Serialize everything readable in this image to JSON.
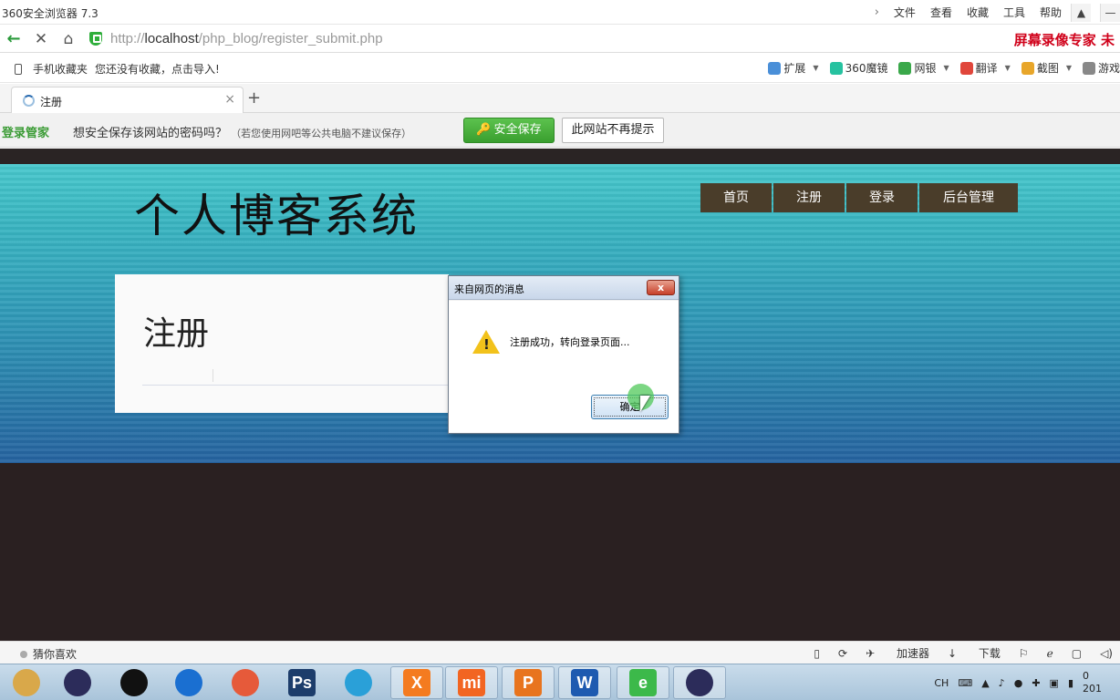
{
  "browser": {
    "title": "360安全浏览器 7.3",
    "menu": [
      "文件",
      "查看",
      "收藏",
      "工具",
      "帮助"
    ],
    "url_scheme": "http://",
    "url_host": "localhost",
    "url_path": "/php_blog/register_submit.php",
    "recorder_brand": "屏幕录像专家 未"
  },
  "bookmarks": {
    "mobile_label": "手机收藏夹",
    "empty_hint": "您还没有收藏，点击导入!",
    "tools": [
      {
        "label": "扩展",
        "color": "#4a8fd8"
      },
      {
        "label": "360魔镜",
        "color": "#26c2a0"
      },
      {
        "label": "网银",
        "color": "#3aa84a"
      },
      {
        "label": "翻译",
        "color": "#e0463b"
      },
      {
        "label": "截图",
        "color": "#e8a62a"
      },
      {
        "label": "游戏",
        "color": "#888888"
      }
    ]
  },
  "tab": {
    "title": "注册",
    "close": "×",
    "new_tab": "+"
  },
  "password_bar": {
    "brand": "登录管家",
    "question": "想安全保存该网站的密码吗？",
    "note": "（若您使用网吧等公共电脑不建议保存）",
    "save_label": "安全保存",
    "dismiss_label": "此网站不再提示"
  },
  "site": {
    "title": "个人博客系统",
    "nav": [
      {
        "label": "首页",
        "width": 78
      },
      {
        "label": "注册",
        "width": 78
      },
      {
        "label": "登录",
        "width": 78
      },
      {
        "label": "后台管理",
        "width": 108
      }
    ],
    "panel_heading": "注册"
  },
  "dialog": {
    "title": "来自网页的消息",
    "message": "注册成功，转向登录页面...",
    "ok_label": "确定",
    "close_glyph": "x"
  },
  "statusbar": {
    "guess": "猜你喜欢",
    "accelerator": "加速器",
    "download": "下载"
  },
  "taskbar": {
    "apps": [
      {
        "name": "file-explorer",
        "color": "#d9a84a",
        "glyph": ""
      },
      {
        "name": "eclipse",
        "color": "#2c2c5a",
        "glyph": ""
      },
      {
        "name": "qq",
        "color": "#111111",
        "glyph": ""
      },
      {
        "name": "qq-2",
        "color": "#1a6fd1",
        "glyph": ""
      },
      {
        "name": "chrome-like",
        "color": "#e65a3a",
        "glyph": ""
      },
      {
        "name": "photoshop",
        "color": "#1d3d6b",
        "glyph": "Ps"
      },
      {
        "name": "feiq",
        "color": "#2aa0d8",
        "glyph": ""
      },
      {
        "name": "xampp",
        "color": "#f47b20",
        "glyph": "X"
      },
      {
        "name": "mi",
        "color": "#f26522",
        "glyph": "mi"
      },
      {
        "name": "wps-p",
        "color": "#e8741e",
        "glyph": "P"
      },
      {
        "name": "wps-w",
        "color": "#1e5ab0",
        "glyph": "W"
      },
      {
        "name": "360-browser",
        "color": "#3cb94a",
        "glyph": "e"
      },
      {
        "name": "eclipse-2",
        "color": "#2c2c5a",
        "glyph": ""
      }
    ],
    "ime": "CH",
    "time_partial": "0",
    "date_partial": "201"
  }
}
